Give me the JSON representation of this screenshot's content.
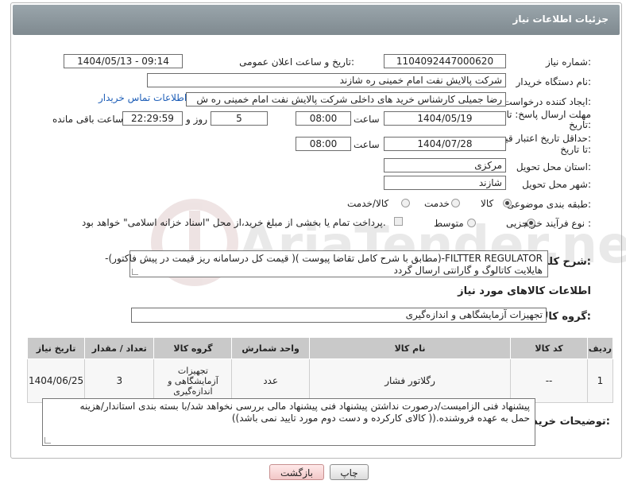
{
  "header": {
    "title": "جزئیات اطلاعات نیاز"
  },
  "fields": {
    "need_number_label": "شماره نیاز:",
    "need_number": "1104092447000620",
    "announce_label": "تاریخ و ساعت اعلان عمومی:",
    "announce_value": "1404/05/13 - 09:14",
    "buyer_org_label": "نام دستگاه خریدار:",
    "buyer_org": "شرکت پالایش نفت امام خمینی  ره  شازند",
    "creator_label": "ایجاد کننده درخواست:",
    "creator": "رضا جمیلی کارشناس خرید های داخلی  شرکت پالایش نفت امام خمینی  ره  ش",
    "contact_link": "اطلاعات تماس خریدار",
    "deadline_label_1": "مهلت ارسال پاسخ: تا",
    "deadline_label_2": "تاریخ:",
    "deadline_date": "1404/05/19",
    "time_label": "ساعت",
    "deadline_time": "08:00",
    "days_value": "5",
    "days_label": "روز و",
    "remaining_time": "22:29:59",
    "remaining_label": "ساعت باقی مانده",
    "validity_label_1": "حداقل تاریخ اعتبار قیمت:",
    "validity_label_2": "تا تاریخ:",
    "validity_date": "1404/07/28",
    "validity_time": "08:00",
    "province_label": "استان محل تحویل:",
    "province": "مرکزی",
    "city_label": "شهر محل تحویل:",
    "city": "شازند",
    "category_label": "طبقه بندی موضوعی:",
    "category_options": [
      "کالا",
      "خدمت",
      "کالا/خدمت"
    ],
    "process_label": "نوع فرآیند خرید :",
    "process_options": [
      "جزیی",
      "متوسط"
    ],
    "payment_note": "پرداخت تمام یا بخشی از مبلغ خرید،از محل \"اسناد خزانه اسلامی\" خواهد بود."
  },
  "summary": {
    "label": "شرح کلی نیاز:",
    "line1": "FILTTER REGULATOR-(مطابق با شرح کامل تقاضا پیوست )( قیمت کل درسامانه ریز قیمت در پیش فاکتور)-",
    "line2": "هایلایت کاتالوگ و گارانتی ارسال گردد"
  },
  "goods": {
    "section_title": "اطلاعات کالاهای مورد نیاز",
    "group_label": "گروه کالا:",
    "group_value": "تجهیزات آزمایشگاهی و اندازه‌گیری"
  },
  "table": {
    "headers": [
      "ردیف",
      "کد کالا",
      "نام کالا",
      "واحد شمارش",
      "گروه کالا",
      "تعداد / مقدار",
      "تاریخ نیاز"
    ],
    "rows": [
      {
        "row": "1",
        "code": "--",
        "name": "رگلاتور فشار",
        "unit": "عدد",
        "group": "تجهیزات آزمایشگاهی و اندازه‌گیری",
        "qty": "3",
        "date": "1404/06/25"
      }
    ]
  },
  "notes": {
    "label": "توضیحات خریدار:",
    "line1": "پیشنهاد فنی الزامیست/درصورت نداشتن پیشنهاد فنی پیشنهاد مالی بررسی نخواهد شد/با بسته بندی استاندار/هزینه",
    "line2": "حمل به عهده فروشنده.(( کالای کارکرده و دست دوم مورد تایید نمی باشد))"
  },
  "buttons": {
    "print": "چاپ",
    "back": "بازگشت"
  },
  "watermark": {
    "text": "AriaTender.net"
  },
  "colors": {
    "header": "#8e999f",
    "link": "#1f5fb8",
    "back_button": "#f2c7c7"
  }
}
